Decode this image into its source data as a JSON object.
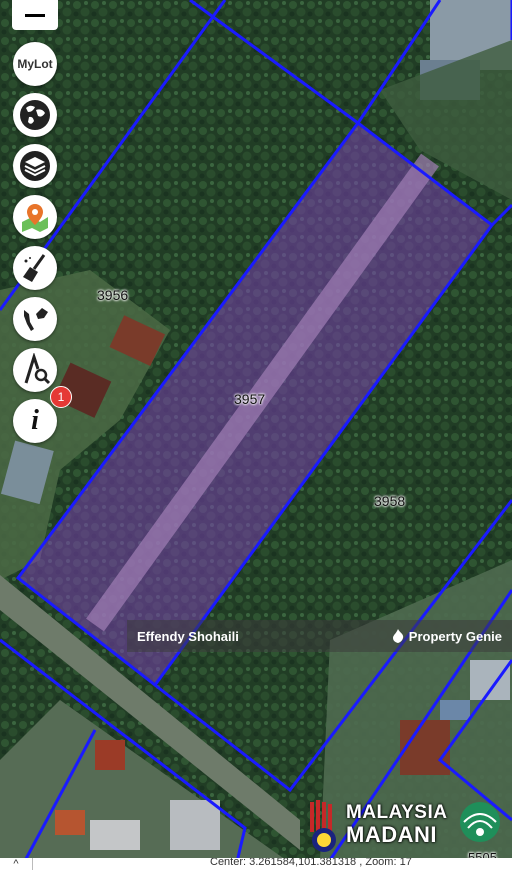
{
  "toolbar": {
    "mylot_label": "MyLot",
    "info_label": "i",
    "notification_count": "1",
    "icons": [
      "menu-icon",
      "mylot-icon",
      "globe-icon",
      "layers-icon",
      "map-pin-icon",
      "broom-icon",
      "malaysia-map-icon",
      "measure-search-icon",
      "info-icon"
    ]
  },
  "lots": {
    "lot_3956": "3956",
    "lot_3957": "3957",
    "lot_3958": "3958",
    "lot_5505": "5505"
  },
  "watermark": {
    "photographer": "Effendy Shohaili",
    "brand": "Property Genie"
  },
  "logo": {
    "line1": "MALAYSIA",
    "line2": "MADANI"
  },
  "status_bar": {
    "caret": "^",
    "center_text": "Center: 3.261584,101.381318 , Zoom: 17"
  },
  "colors": {
    "boundary": "#1a1aff",
    "highlight": "#7a3fb0",
    "vegetation": "#1f3d22"
  }
}
